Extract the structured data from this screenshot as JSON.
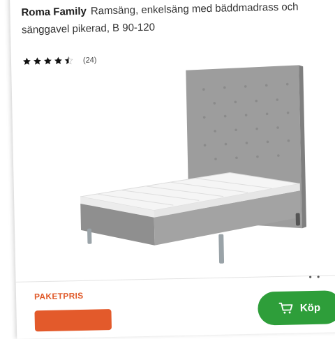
{
  "product": {
    "brand": "Roma Family",
    "description": "Ramsäng, enkelsäng med bäddmadrass och sänggavel pikerad, B 90-120",
    "rating": 4.5,
    "rating_max": 5,
    "review_count": "(24)"
  },
  "gallery": {
    "image_alt": "Grey upholstered single bed with tufted headboard and mattress",
    "dots": "• •"
  },
  "pricing": {
    "label": "PAKETPRIS"
  },
  "actions": {
    "buy_label": "Köp",
    "buy_icon": "cart-icon",
    "button_color": "#2e9e3a",
    "accent_color": "#e05a2a"
  }
}
